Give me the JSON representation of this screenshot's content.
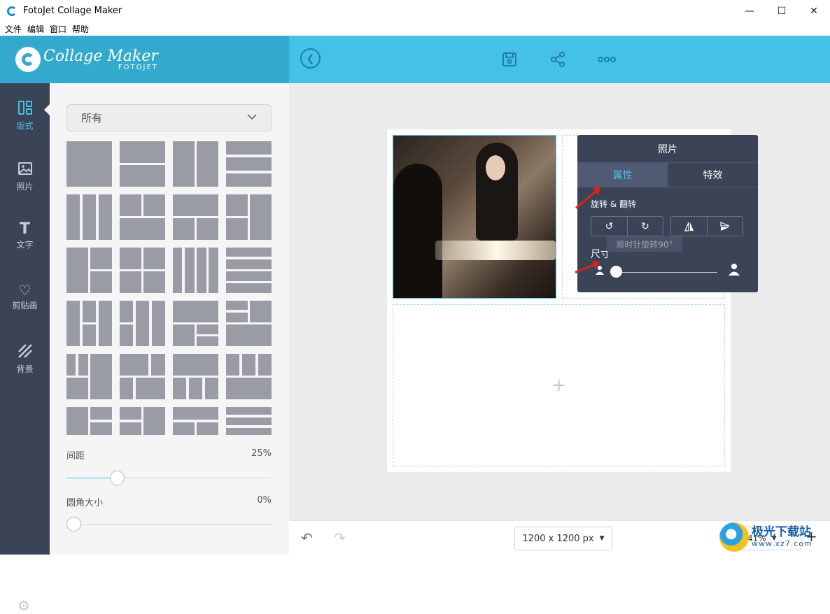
{
  "window": {
    "title": "FotoJet Collage Maker",
    "minimize": "—",
    "maximize": "☐",
    "close": "✕"
  },
  "menu": [
    "文件",
    "编辑",
    "窗口",
    "帮助"
  ],
  "header": {
    "logo_main": "Collage Maker",
    "logo_sub": "FOTOJET"
  },
  "leftnav": [
    {
      "label": "版式",
      "icon": "layout-icon"
    },
    {
      "label": "照片",
      "icon": "photo-icon"
    },
    {
      "label": "文字",
      "icon": "text-icon"
    },
    {
      "label": "剪贴画",
      "icon": "heart-icon"
    },
    {
      "label": "背景",
      "icon": "background-icon"
    }
  ],
  "panel": {
    "filter_value": "所有",
    "spacing_label": "间距",
    "spacing_value": "25%",
    "spacing_level": 0.25,
    "corner_label": "圆角大小",
    "corner_value": "0%",
    "corner_level": 0
  },
  "popup": {
    "title": "照片",
    "tab_active": "属性",
    "tab_other": "特效",
    "rotate_section": "旋转 & 翻转",
    "tooltip": "顺时针旋转90°",
    "size_label": "尺寸"
  },
  "bottombar": {
    "canvas_size": "1200 x 1200 px",
    "zoom": "41%"
  },
  "watermark": {
    "main": "极光下载站",
    "sub": "www.xz7.com"
  },
  "colors": {
    "accent": "#45c1e6",
    "header_dark": "#32a9cd",
    "nav_bg": "#3b4357",
    "tile": "#999ca4"
  }
}
